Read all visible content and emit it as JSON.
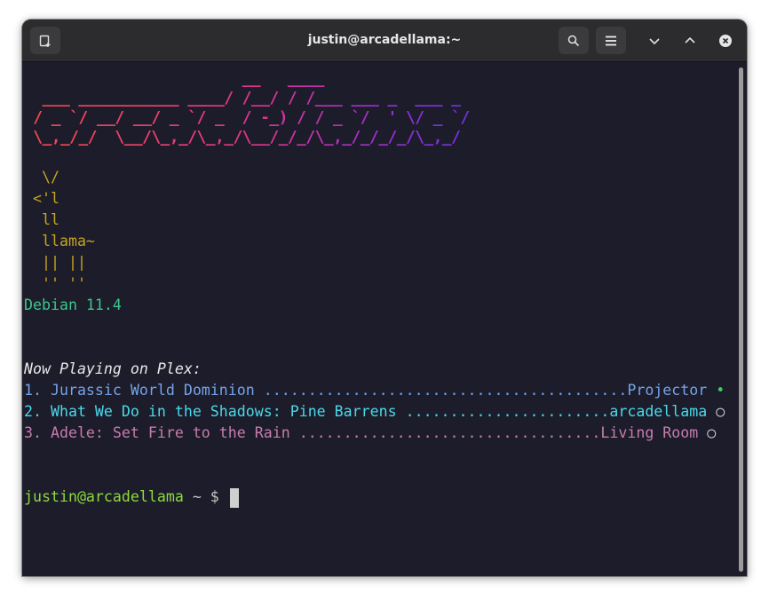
{
  "window": {
    "title": "justin@arcadellama:~"
  },
  "toolbar": {
    "new_tab_icon": "new-tab-icon",
    "search_icon": "search-icon",
    "menu_icon": "hamburger-menu-icon",
    "minimize_icon": "chevron-down-icon",
    "maximize_icon": "chevron-up-icon",
    "close_icon": "close-icon"
  },
  "terminal": {
    "banner_art": [
      "                        __   ____",
      "  ___ ___________ ____/ /__/ / /___ ___ _  ___ _",
      " / _ `/ __/ __/ _ `/ _  / -_) / / _ `/  ' \\/ _ `/",
      " \\_,_/_/  \\__/\\_,_/\\_,_/\\__/_/_/\\_,_/_/_/_/\\_,_/"
    ],
    "llama_art": [
      "  \\/",
      " <'l",
      "  ll",
      "  llama~",
      "  || ||",
      "  '' ''"
    ],
    "os_version": "Debian 11.4",
    "now_playing_title": "Now Playing on Plex:",
    "now_playing": [
      {
        "text": "1. Jurassic World Dominion .........................................Projector",
        "status": "•"
      },
      {
        "text": "2. What We Do in the Shadows: Pine Barrens .......................arcadellama",
        "status": "○"
      },
      {
        "text": "3. Adele: Set Fire to the Rain ..................................Living Room",
        "status": "○"
      }
    ],
    "prompt_user_host": "justin@arcadellama",
    "prompt_symbol": " ~ $ "
  },
  "colors": {
    "terminal_bg": "#1d1c2a",
    "titlebar_bg": "#2c2c2e",
    "llama": "#c6a51e",
    "os": "#3cc78c",
    "row1": "#74a3e8",
    "row2": "#49d9e9",
    "row3": "#c67dad",
    "prompt": "#8cdb3d"
  }
}
